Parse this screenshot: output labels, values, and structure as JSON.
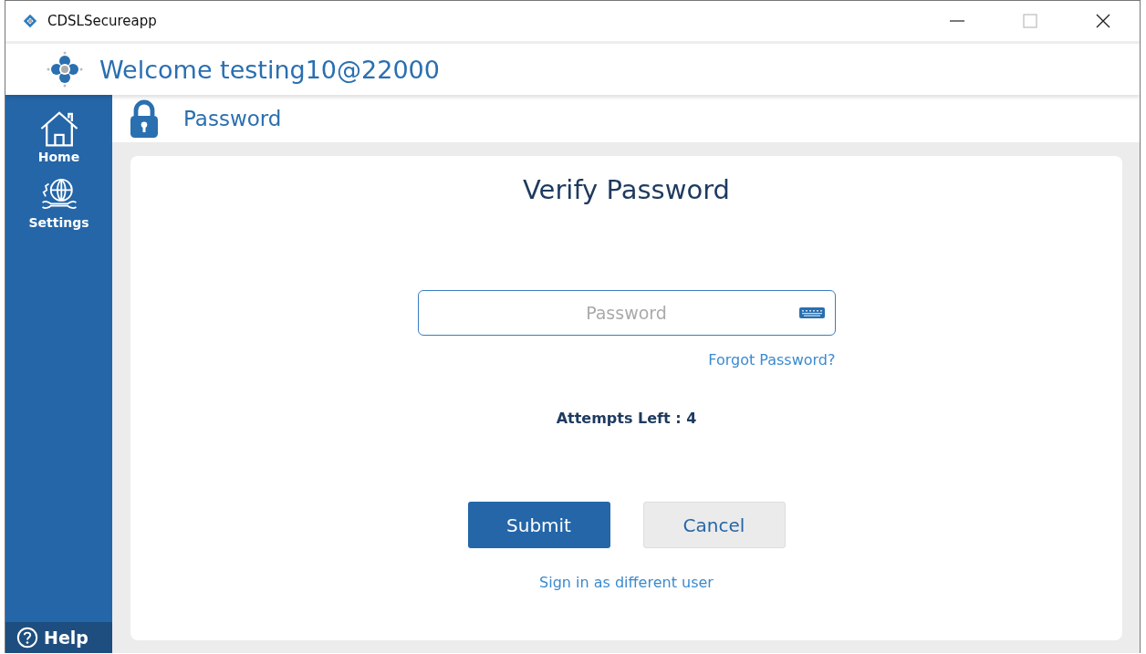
{
  "window": {
    "title": "CDSLSecureapp"
  },
  "header": {
    "welcome": "Welcome testing10@22000"
  },
  "sidebar": {
    "items": [
      {
        "label": "Home",
        "kind": "home"
      },
      {
        "label": "Settings",
        "kind": "settings"
      }
    ],
    "help": "Help"
  },
  "page": {
    "title": "Password"
  },
  "card": {
    "heading": "Verify Password",
    "password": {
      "placeholder": "Password"
    },
    "forgot": "Forgot Password?",
    "attempts": "Attempts Left : 4",
    "buttons": [
      {
        "label": "Submit",
        "kind": "primary"
      },
      {
        "label": "Cancel",
        "kind": "secondary"
      }
    ],
    "switch_user": "Sign in as different user"
  }
}
